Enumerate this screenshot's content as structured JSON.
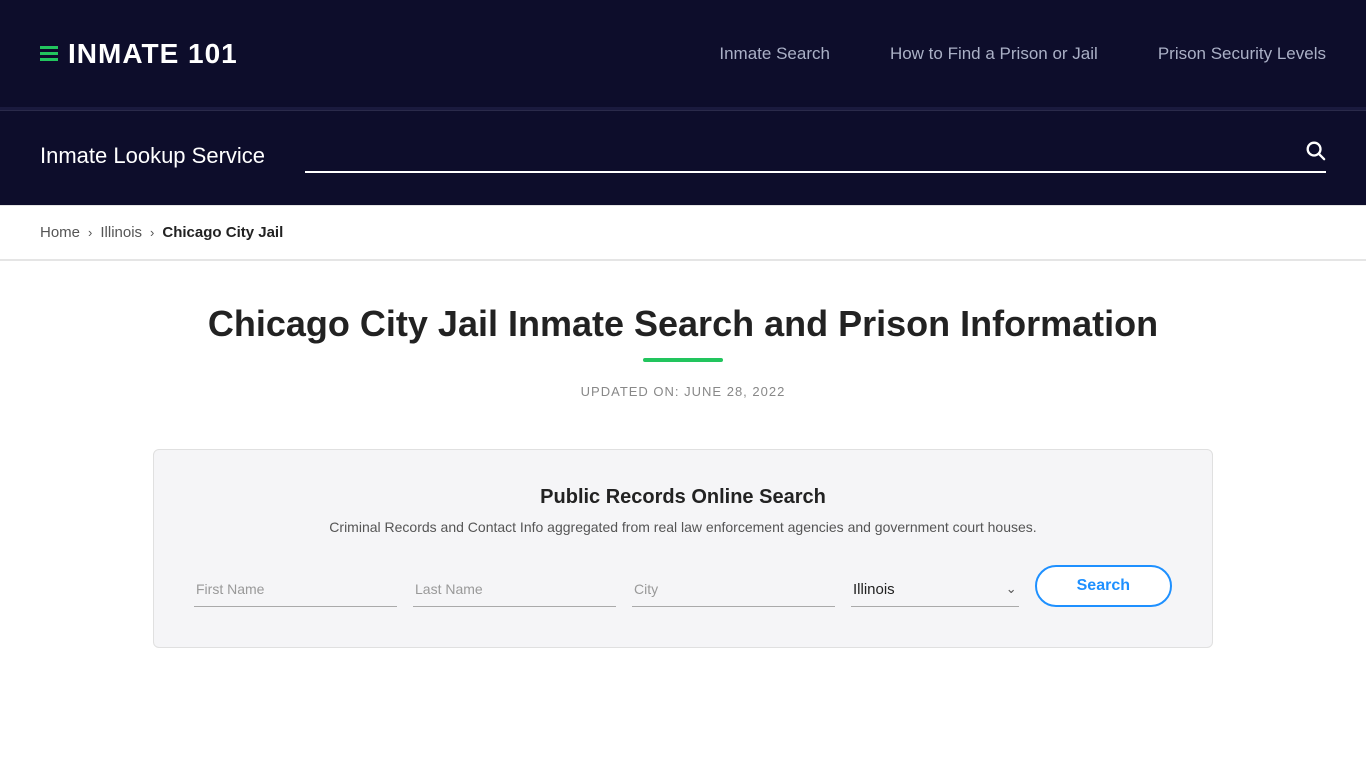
{
  "site": {
    "logo_text": "INMATE 101",
    "logo_icon_bars": 3
  },
  "nav": {
    "links": [
      {
        "label": "Inmate Search",
        "href": "#"
      },
      {
        "label": "How to Find a Prison or Jail",
        "href": "#"
      },
      {
        "label": "Prison Security Levels",
        "href": "#"
      }
    ]
  },
  "search_bar": {
    "label": "Inmate Lookup Service",
    "placeholder": ""
  },
  "breadcrumb": {
    "home": "Home",
    "state": "Illinois",
    "current": "Chicago City Jail"
  },
  "main": {
    "page_title": "Chicago City Jail Inmate Search and Prison Information",
    "updated_label": "UPDATED ON: JUNE 28, 2022"
  },
  "search_card": {
    "title": "Public Records Online Search",
    "description": "Criminal Records and Contact Info aggregated from real law enforcement agencies and government court houses.",
    "first_name_placeholder": "First Name",
    "last_name_placeholder": "Last Name",
    "city_placeholder": "City",
    "state_value": "Illinois",
    "search_button_label": "Search"
  }
}
